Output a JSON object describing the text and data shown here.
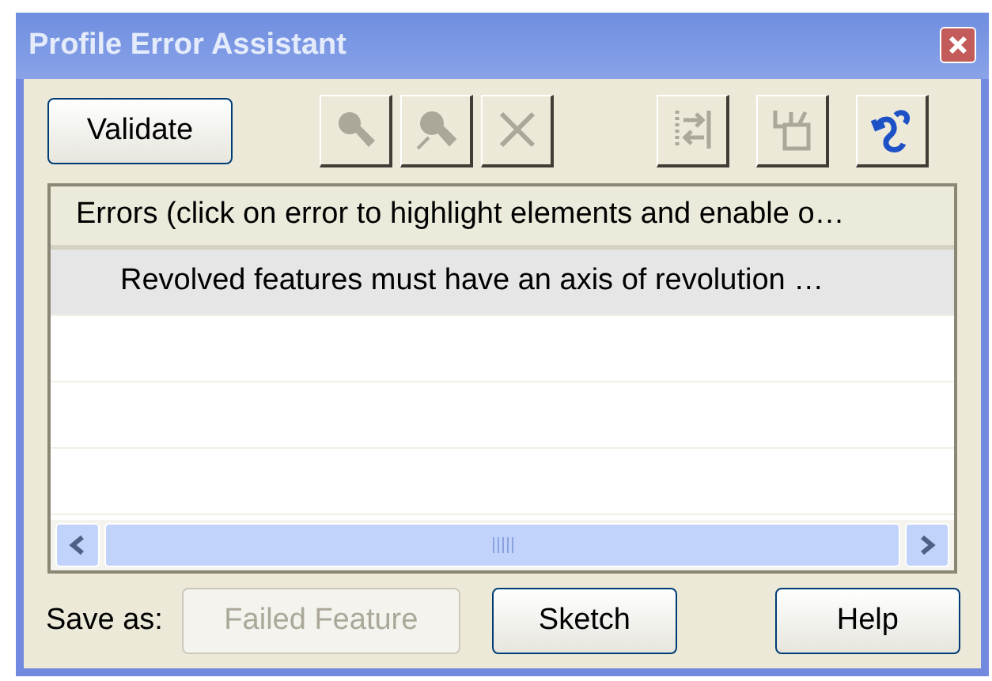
{
  "window": {
    "title": "Profile Error Assistant"
  },
  "toolbar": {
    "validate": "Validate",
    "tools": [
      {
        "kind": "zoom",
        "disabled": true
      },
      {
        "kind": "zoom-fit",
        "disabled": true
      },
      {
        "kind": "delete",
        "disabled": true
      },
      {
        "kind": "swap",
        "disabled": true
      },
      {
        "kind": "sketch",
        "disabled": true
      },
      {
        "kind": "repair",
        "disabled": false
      }
    ]
  },
  "errors_list": {
    "header": "Errors (click on error to highlight elements and enable o…",
    "rows": [
      {
        "text": "Revolved features must have an axis of revolution …",
        "selected": true
      }
    ]
  },
  "footer": {
    "save_as_label": "Save as:",
    "buttons": [
      {
        "label": "Failed Feature",
        "disabled": true
      },
      {
        "label": "Sketch",
        "disabled": false
      },
      {
        "label": "Help",
        "disabled": false
      }
    ]
  }
}
